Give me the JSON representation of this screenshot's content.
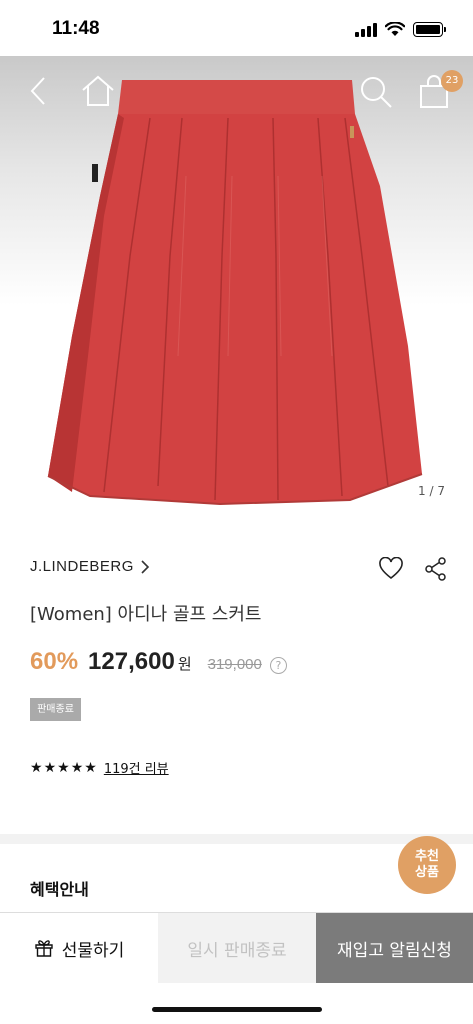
{
  "status_bar": {
    "time": "11:48"
  },
  "nav": {
    "cart_count": "23"
  },
  "gallery": {
    "pager": "1 / 7"
  },
  "product": {
    "brand": "J.LINDEBERG",
    "name": "[Women] 아디나 골프 스커트",
    "discount": "60%",
    "price": "127,600",
    "currency": "원",
    "original_price": "319,000",
    "help_symbol": "?",
    "status_badge": "판매종료",
    "reviews": "119건 리뷰",
    "stars": [
      "★",
      "★",
      "★",
      "★",
      "★"
    ]
  },
  "benefits": {
    "title": "혜택안내"
  },
  "recommend": {
    "line1": "추천",
    "line2": "상품"
  },
  "bottom_bar": {
    "gift": "선물하기",
    "paused": "일시 판매종료",
    "restock": "재입고 알림신청"
  },
  "colors": {
    "accent": "#e0a064",
    "skirt": "#d84545",
    "restock_bg": "#7b7b7b"
  }
}
